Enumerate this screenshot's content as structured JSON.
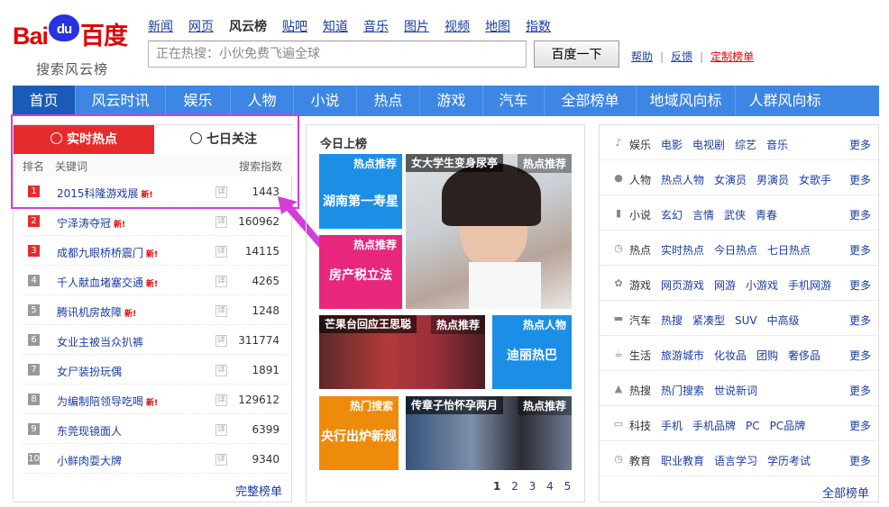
{
  "logo": {
    "text_bai": "Bai",
    "text_du": "du",
    "text_cn": "百度",
    "subtitle": "搜索风云榜"
  },
  "topnav": [
    "新闻",
    "网页",
    "风云榜",
    "贴吧",
    "知道",
    "音乐",
    "图片",
    "视频",
    "地图",
    "指数"
  ],
  "search": {
    "value": "正在热搜：小伙免费飞遍全球",
    "button": "百度一下"
  },
  "links": {
    "help": "帮助",
    "feedback": "反馈",
    "custom": "定制榜单"
  },
  "mainnav": [
    "首页",
    "风云时讯",
    "娱乐",
    "人物",
    "小说",
    "热点",
    "游戏",
    "汽车",
    "全部榜单",
    "地域风向标",
    "人群风向标"
  ],
  "left": {
    "tab_active": "实时热点",
    "tab_inactive": "七日关注",
    "col_rank": "排名",
    "col_keyword": "关键词",
    "col_index": "搜索指数",
    "rows": [
      {
        "rank": "1",
        "keyword": "2015科隆游戏展",
        "new": true,
        "index": "1443"
      },
      {
        "rank": "2",
        "keyword": "宁泽涛夺冠",
        "new": true,
        "index": "160962"
      },
      {
        "rank": "3",
        "keyword": "成都九眼桥桥震门",
        "new": true,
        "index": "14115"
      },
      {
        "rank": "4",
        "keyword": "千人献血堵塞交通",
        "new": true,
        "index": "4265"
      },
      {
        "rank": "5",
        "keyword": "腾讯机房故障",
        "new": true,
        "index": "1248"
      },
      {
        "rank": "6",
        "keyword": "女业主被当众扒裤",
        "new": false,
        "index": "311774"
      },
      {
        "rank": "7",
        "keyword": "女尸装扮玩偶",
        "new": false,
        "index": "1891"
      },
      {
        "rank": "8",
        "keyword": "为编制陪领导吃喝",
        "new": true,
        "index": "129612"
      },
      {
        "rank": "9",
        "keyword": "东莞现镜面人",
        "new": false,
        "index": "6399"
      },
      {
        "rank": "10",
        "keyword": "小鲜肉耍大牌",
        "new": false,
        "index": "9340"
      }
    ],
    "new_label": "新!",
    "detail_label": "详",
    "full_link": "完整榜单"
  },
  "mid": {
    "title": "今日上榜",
    "tiles": [
      {
        "tag": "热点推荐",
        "caption": "湖南第一寿星"
      },
      {
        "tag": "热点推荐",
        "overlay": "女大学生变身尿亭"
      },
      {
        "tag": "热点推荐",
        "caption": "房产税立法"
      },
      {
        "tag": "热点推荐",
        "overlay": "芒果台回应王思聪"
      },
      {
        "tag": "热点人物",
        "caption": "迪丽热巴"
      },
      {
        "tag": "热门搜索",
        "caption": "央行出炉新规"
      },
      {
        "tag": "热点推荐",
        "overlay": "传章子怡怀孕两月"
      }
    ],
    "pages": [
      "1",
      "2",
      "3",
      "4",
      "5"
    ]
  },
  "right": {
    "categories": [
      {
        "icon": "music-icon",
        "glyph": "♪",
        "name": "娱乐",
        "subs": [
          "电影",
          "电视剧",
          "综艺",
          "音乐"
        ]
      },
      {
        "icon": "person-icon",
        "glyph": "●",
        "name": "人物",
        "subs": [
          "热点人物",
          "女演员",
          "男演员",
          "女歌手"
        ]
      },
      {
        "icon": "book-icon",
        "glyph": "▮",
        "name": "小说",
        "subs": [
          "玄幻",
          "言情",
          "武侠",
          "青春"
        ]
      },
      {
        "icon": "clock-icon",
        "glyph": "◷",
        "name": "热点",
        "subs": [
          "实时热点",
          "今日热点",
          "七日热点"
        ]
      },
      {
        "icon": "gamepad-icon",
        "glyph": "✿",
        "name": "游戏",
        "subs": [
          "网页游戏",
          "网游",
          "小游戏",
          "手机网游"
        ]
      },
      {
        "icon": "car-icon",
        "glyph": "▬",
        "name": "汽车",
        "subs": [
          "热搜",
          "紧凑型",
          "SUV",
          "中高级"
        ]
      },
      {
        "icon": "cup-icon",
        "glyph": "☕",
        "name": "生活",
        "subs": [
          "旅游城市",
          "化妆品",
          "团购",
          "奢侈品"
        ]
      },
      {
        "icon": "fire-icon",
        "glyph": "▲",
        "name": "热搜",
        "subs": [
          "热门搜索",
          "世说新词"
        ]
      },
      {
        "icon": "monitor-icon",
        "glyph": "▭",
        "name": "科技",
        "subs": [
          "手机",
          "手机品牌",
          "PC",
          "PC品牌"
        ]
      },
      {
        "icon": "clock-icon",
        "glyph": "◷",
        "name": "教育",
        "subs": [
          "职业教育",
          "语言学习",
          "学历考试"
        ]
      }
    ],
    "more": "更多",
    "all_link": "全部榜单"
  },
  "colors": {
    "brand_red": "#e10602",
    "brand_blue": "#2932e1",
    "nav_blue": "#3d86e4",
    "highlight": "#d23fd8",
    "link": "#1a3ca6"
  }
}
